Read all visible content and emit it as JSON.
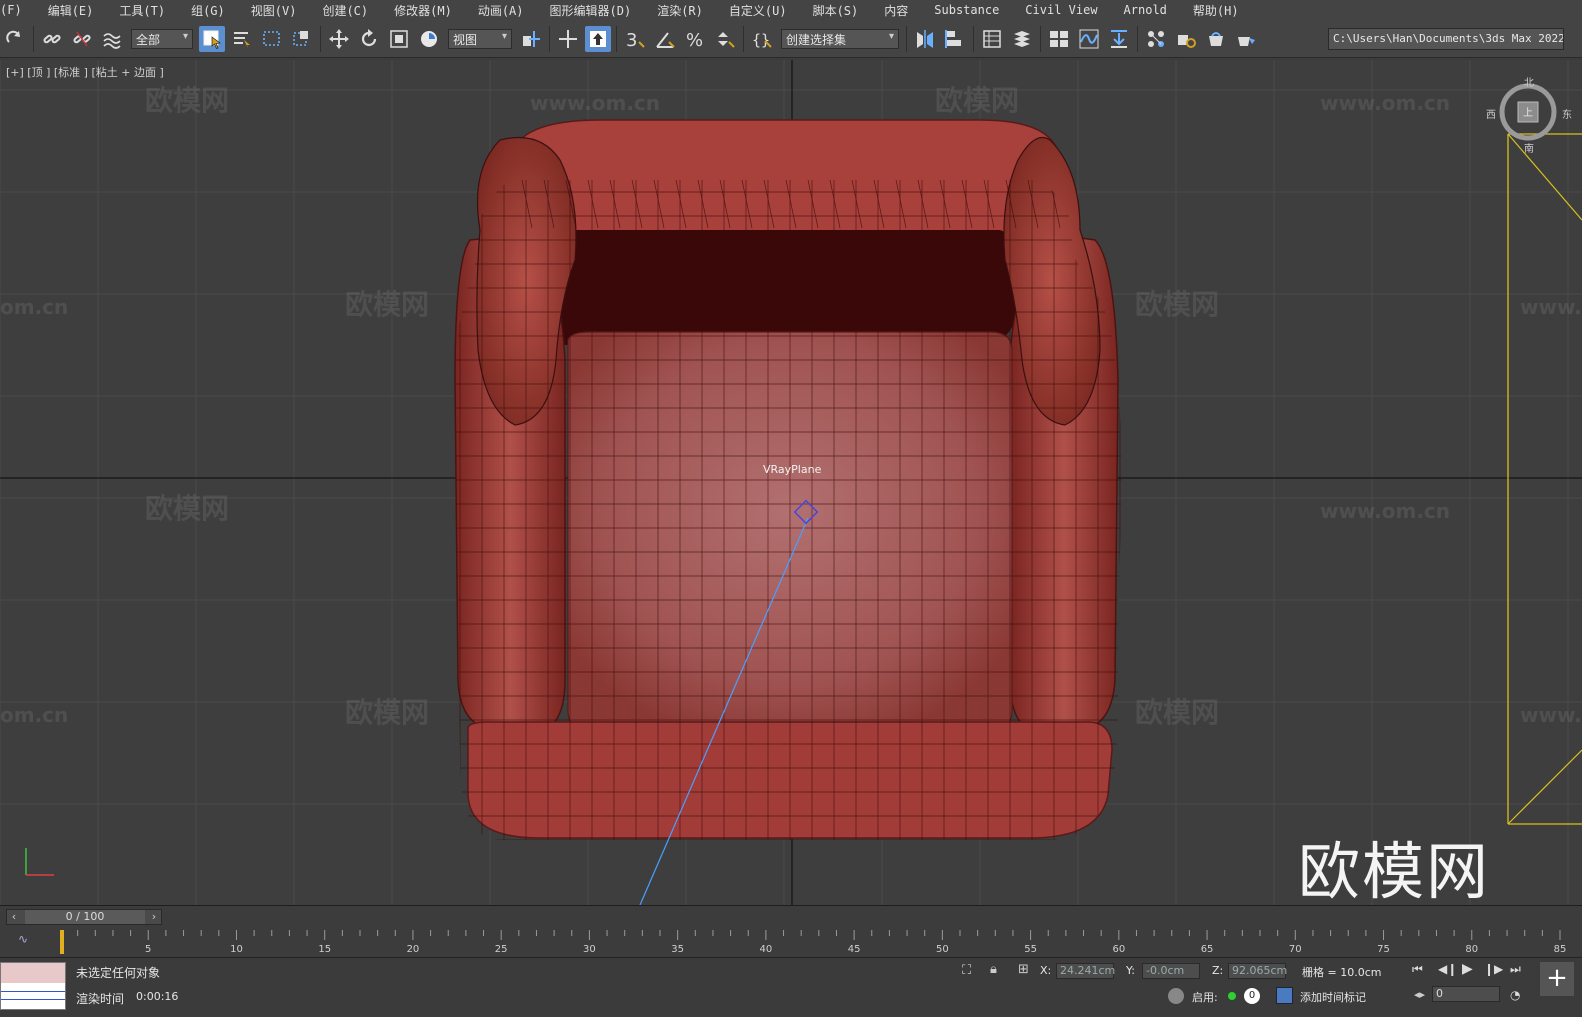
{
  "menu": [
    "(F)",
    "编辑(E)",
    "工具(T)",
    "组(G)",
    "视图(V)",
    "创建(C)",
    "修改器(M)",
    "动画(A)",
    "图形编辑器(D)",
    "渲染(R)",
    "自定义(U)",
    "脚本(S)",
    "内容",
    "Substance",
    "Civil View",
    "Arnold",
    "帮助(H)"
  ],
  "toolbar": {
    "selection_filter": "全部",
    "reference_coord": "视图",
    "named_selection": "创建选择集",
    "project_path": "C:\\Users\\Han\\Documents\\3ds Max 2022"
  },
  "viewport": {
    "label": "[+] [顶 ] [标准 ] [粘土 + 边面 ]",
    "object_label": "VRayPlane",
    "viewcube": {
      "north": "北",
      "west": "西",
      "east": "东",
      "south": "南",
      "face": "上"
    }
  },
  "watermarks": {
    "cn": "欧模网",
    "url": "www.om.cn",
    "fragment": "om.cn",
    "fragment2": "www.",
    "brand": "欧模网"
  },
  "timeline": {
    "frame_display": "0 / 100",
    "ticks": [
      "5",
      "10",
      "15",
      "20",
      "25",
      "30",
      "35",
      "40",
      "45",
      "50",
      "55",
      "60",
      "65",
      "70",
      "75",
      "80",
      "85"
    ],
    "current_frame": 0,
    "total_frames": 100
  },
  "status": {
    "selection": "未选定任何对象",
    "render_time_label": "渲染时间",
    "render_time": "0:00:16",
    "x_label": "X:",
    "x_value": "24.241cm",
    "y_label": "Y:",
    "y_value": "-0.0cm",
    "z_label": "Z:",
    "z_value": "92.065cm",
    "grid": "栅格 = 10.0cm",
    "enable_label": "启用:",
    "enable_count": "0",
    "add_time_tag": "添加时间标记",
    "frame_input": "0"
  },
  "colors": {
    "sofa": "#a8403c",
    "sofa_dark": "#5a1010",
    "selection_blue": "#5b8fd0",
    "grid_line": "#4a4a4a",
    "axis_line": "#141414",
    "camera_yellow": "#d8c020",
    "target_line": "#4aa0ff"
  }
}
